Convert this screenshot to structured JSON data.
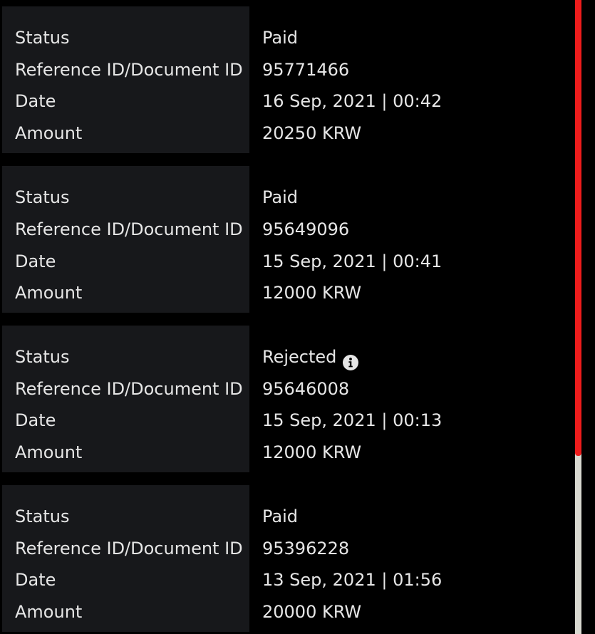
{
  "transactions": [
    {
      "status_label": "Status",
      "status": "Paid",
      "reference_label": "Reference ID/Document ID",
      "reference": "95771466",
      "date_label": "Date",
      "date": "16 Sep, 2021 | 00:42",
      "amount_label": "Amount",
      "amount": "20250 KRW"
    },
    {
      "status_label": "Status",
      "status": "Paid",
      "reference_label": "Reference ID/Document ID",
      "reference": "95649096",
      "date_label": "Date",
      "date": "15 Sep, 2021 | 00:41",
      "amount_label": "Amount",
      "amount": "12000 KRW"
    },
    {
      "status_label": "Status",
      "status": "Rejected",
      "status_icon": "info-icon",
      "reference_label": "Reference ID/Document ID",
      "reference": "95646008",
      "date_label": "Date",
      "date": "15 Sep, 2021 | 00:13",
      "amount_label": "Amount",
      "amount": "12000 KRW"
    },
    {
      "status_label": "Status",
      "status": "Paid",
      "reference_label": "Reference ID/Document ID",
      "reference": "95396228",
      "date_label": "Date",
      "date": "13 Sep, 2021 | 01:56",
      "amount_label": "Amount",
      "amount": "20000 KRW"
    }
  ],
  "colors": {
    "background": "#000000",
    "card": "#17181b",
    "text": "#e6e6e6",
    "scrollbar_thumb": "#ee1c1c",
    "scrollbar_track": "#d8d8d0"
  }
}
